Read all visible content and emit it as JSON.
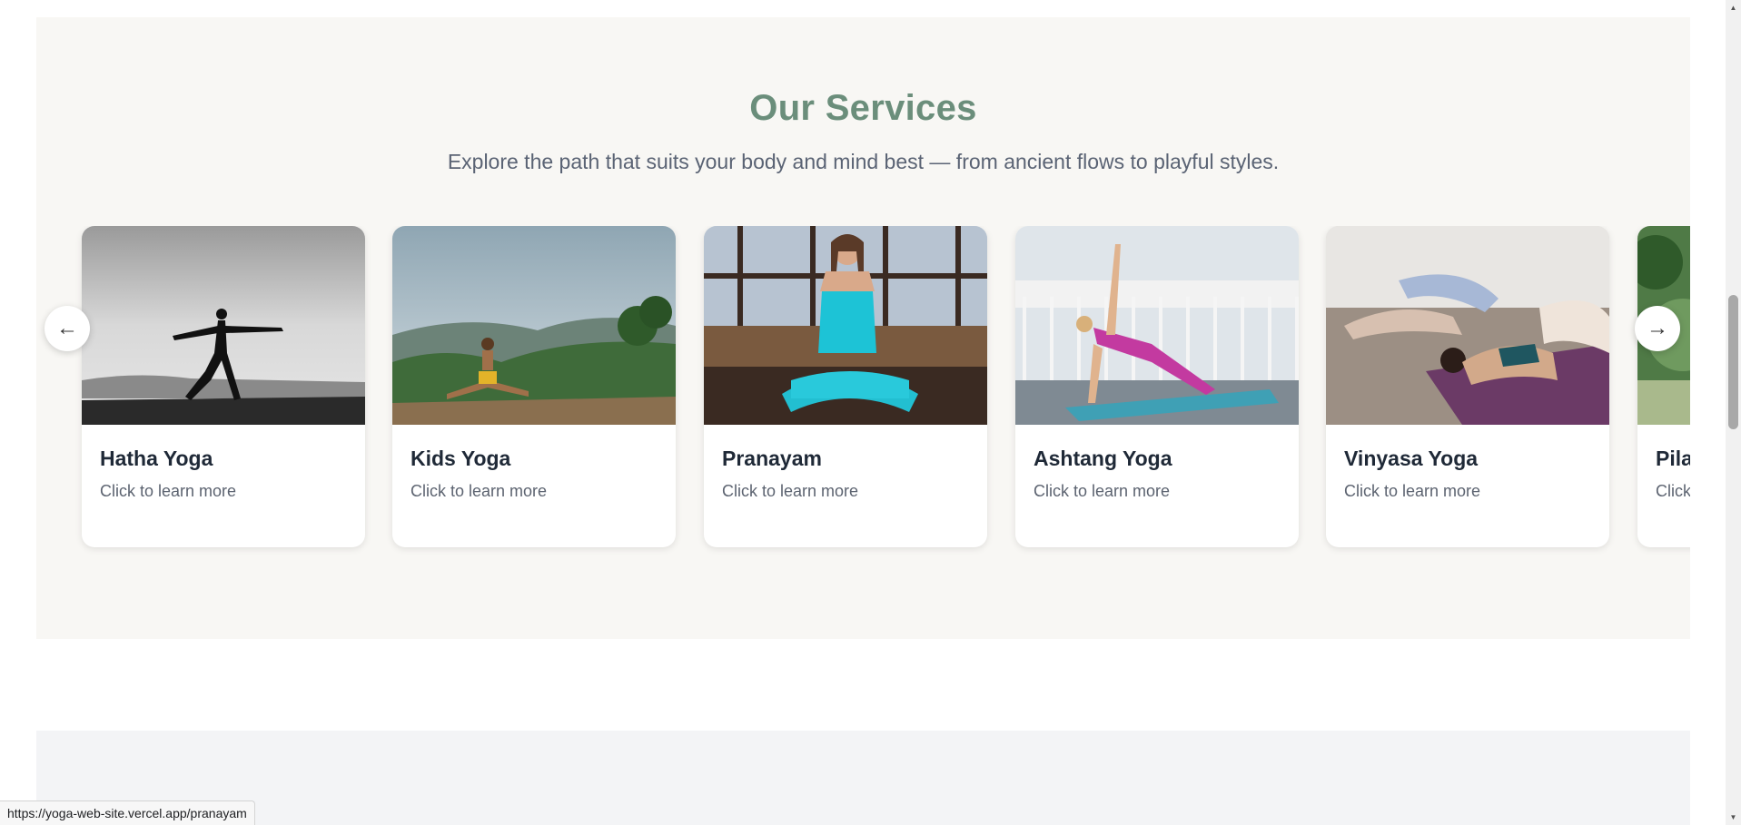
{
  "services": {
    "title": "Our Services",
    "subtitle": "Explore the path that suits your body and mind best — from ancient flows to playful styles.",
    "cards": [
      {
        "title": "Hatha Yoga",
        "subtitle": "Click to learn more",
        "image_icon": "yoga-warrior-pose-photo"
      },
      {
        "title": "Kids Yoga",
        "subtitle": "Click to learn more",
        "image_icon": "child-meditating-mountains-photo"
      },
      {
        "title": "Pranayam",
        "subtitle": "Click to learn more",
        "image_icon": "breathing-meditation-photo"
      },
      {
        "title": "Ashtang Yoga",
        "subtitle": "Click to learn more",
        "image_icon": "side-angle-pose-deck-photo"
      },
      {
        "title": "Vinyasa Yoga",
        "subtitle": "Click to learn more",
        "image_icon": "stretching-mat-photo"
      },
      {
        "title": "Pila",
        "subtitle": "Click",
        "image_icon": "outdoor-greenery-photo"
      }
    ],
    "prev_label": "←",
    "next_label": "→"
  },
  "status_bar": {
    "url": "https://yoga-web-site.vercel.app/pranayam"
  },
  "colors": {
    "title_green": "#6b8e7b",
    "section_bg": "#f8f7f4",
    "card_title": "#1f2937"
  }
}
